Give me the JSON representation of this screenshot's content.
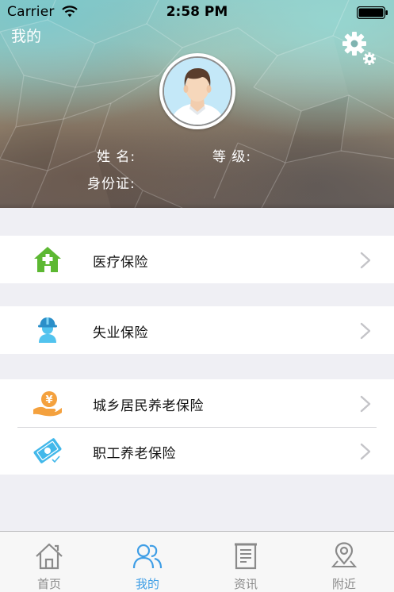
{
  "status_bar": {
    "carrier": "Carrier",
    "time": "2:58 PM",
    "wifi_icon": "wifi-icon",
    "battery_icon": "battery-icon"
  },
  "header": {
    "title": "我的",
    "settings_icon": "gear-icon",
    "avatar_icon": "user-avatar",
    "name_label": "姓 名:",
    "level_label": "等 级:",
    "id_label": "身份证:"
  },
  "menu": {
    "groups": [
      {
        "items": [
          {
            "label": "医疗保险",
            "icon": "house-plus-icon",
            "color": "#5cb832"
          }
        ]
      },
      {
        "items": [
          {
            "label": "失业保险",
            "icon": "worker-icon",
            "color": "#52c3ee"
          }
        ]
      },
      {
        "items": [
          {
            "label": "城乡居民养老保险",
            "icon": "yuan-hand-icon",
            "color": "#f4a13e"
          },
          {
            "label": "职工养老保险",
            "icon": "card-check-icon",
            "color": "#42b8ea"
          }
        ]
      }
    ],
    "chevron_icon": "chevron-right-icon"
  },
  "tab_bar": {
    "tabs": [
      {
        "label": "首页",
        "icon": "home-icon",
        "active": false
      },
      {
        "label": "我的",
        "icon": "users-icon",
        "active": true
      },
      {
        "label": "资讯",
        "icon": "news-icon",
        "active": false
      },
      {
        "label": "附近",
        "icon": "location-pin-icon",
        "active": false
      }
    ],
    "active_color": "#3f9ee6",
    "inactive_color": "#8a8a8a"
  }
}
